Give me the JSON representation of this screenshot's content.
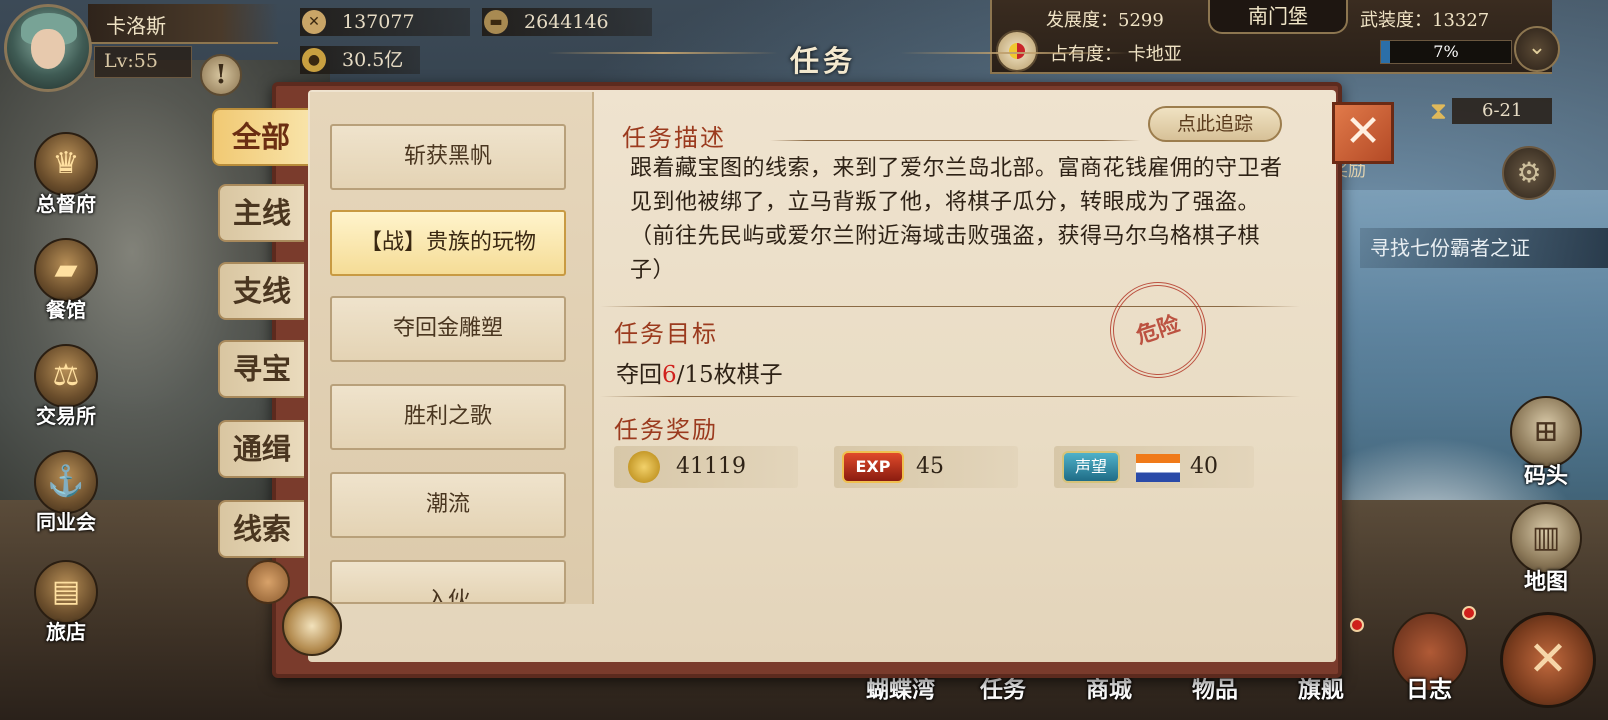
{
  "player": {
    "name": "卡洛斯",
    "level": "Lv:55"
  },
  "resources": {
    "attack": "137077",
    "gold_bars": "2644146",
    "coins": "30.5亿"
  },
  "city": {
    "name": "南门堡",
    "development_label": "发展度：5299",
    "armament_label": "武装度：13327",
    "occupation_label": "占有度：  卡地亚",
    "occupation_percent": "7%",
    "occupation_fraction": 0.07
  },
  "timer": "6-21",
  "quest_banner": "寻找七份霸者之证",
  "reward_peek": "奖励",
  "left_nav": [
    "总督府",
    "餐馆",
    "交易所",
    "同业会",
    "旅店"
  ],
  "right_nav": [
    "码头",
    "地图"
  ],
  "bottom_nav": [
    "蝴蝶湾",
    "任务",
    "商城",
    "物品",
    "旗舰",
    "日志"
  ],
  "dialog": {
    "title": "任务",
    "categories": [
      "全部",
      "主线",
      "支线",
      "寻宝",
      "通缉",
      "线索"
    ],
    "quests": [
      "斩获黑帆",
      "【战】贵族的玩物",
      "夺回金雕塑",
      "胜利之歌",
      "潮流",
      "入伙"
    ],
    "description_title": "任务描述",
    "track_button": "点此追踪",
    "description": "跟着藏宝图的线索，来到了爱尔兰岛北部。富商花钱雇佣的守卫者见到他被绑了，立马背叛了他，将棋子瓜分，转眼成为了强盗。（前往先民屿或爱尔兰附近海域击败强盗，获得马尔乌格棋子棋子）",
    "objective_title": "任务目标",
    "objective": {
      "prefix": "夺回",
      "current": "6",
      "rest": "/15枚棋子"
    },
    "stamp": "危险",
    "reward_title": "任务奖励",
    "rewards": {
      "coins": "41119",
      "exp_label": "EXP",
      "exp": "45",
      "reputation_label": "声望",
      "reputation": "40"
    }
  },
  "colors": {
    "accent": "#9b3a1e",
    "objective_current": "#d0201c",
    "occupation_fill": "#2b6fa8"
  },
  "icons": [
    "attack-icon",
    "gold-bar-icon",
    "coin-icon",
    "alert-icon",
    "crown-icon",
    "close-icon",
    "hourglass-icon",
    "gear-icon",
    "compass-icon"
  ]
}
